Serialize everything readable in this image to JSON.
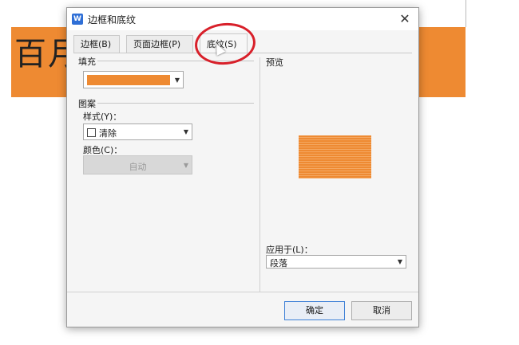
{
  "background_doc": {
    "text": "百月",
    "band_color": "#ee8a32"
  },
  "dialog": {
    "title": "边框和底纹",
    "app_icon": "W",
    "close_symbol": "✕",
    "tabs": [
      {
        "label": "边框(B)"
      },
      {
        "label": "页面边框(P)"
      },
      {
        "label": "底纹(S)",
        "active": true
      }
    ],
    "fill": {
      "label": "填充",
      "color": "#ee8a32"
    },
    "pattern": {
      "label": "图案",
      "style_label": "样式(Y)：",
      "style_value": "清除",
      "color_label": "颜色(C)：",
      "color_value": "自动"
    },
    "preview": {
      "label": "预览"
    },
    "apply_to": {
      "label": "应用于(L)：",
      "value": "段落"
    },
    "buttons": {
      "ok": "确定",
      "cancel": "取消"
    }
  },
  "annotation": {
    "circle_color": "#d8202a"
  }
}
